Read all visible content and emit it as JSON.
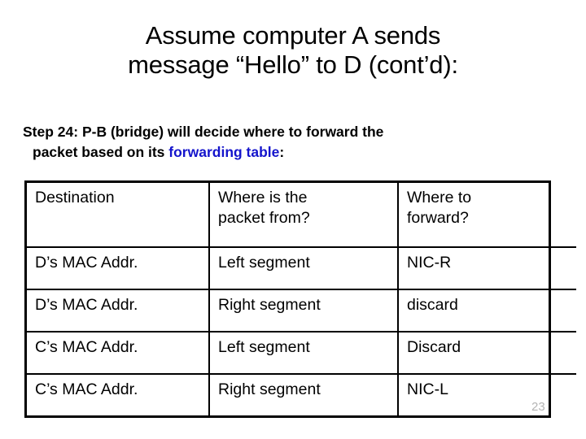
{
  "slide": {
    "title_line_1": "Assume computer A sends",
    "title_line_2": "message “Hello” to D (cont’d):",
    "page_number": "23"
  },
  "step": {
    "line_1": "Step 24: P-B (bridge) will decide where to forward the",
    "line_2_before": "packet based on its ",
    "line_2_highlight": "forwarding table",
    "line_2_after": ":",
    "highlight_color": "#1414CC"
  },
  "table": {
    "headers": {
      "destination": "Destination",
      "where_from_l1": "Where is the",
      "where_from_l2": "packet from?",
      "where_to_l1": "Where to",
      "where_to_l2": "forward?"
    },
    "rows": [
      {
        "destination": "D’s MAC Addr.",
        "where_from": "Left segment",
        "where_to": "NIC-R"
      },
      {
        "destination": "D’s MAC Addr.",
        "where_from": "Right segment",
        "where_to": "discard"
      },
      {
        "destination": "C’s MAC Addr.",
        "where_from": "Left segment",
        "where_to": "Discard"
      },
      {
        "destination": "C’s MAC Addr.",
        "where_from": "Right segment",
        "where_to": "NIC-L"
      }
    ]
  }
}
